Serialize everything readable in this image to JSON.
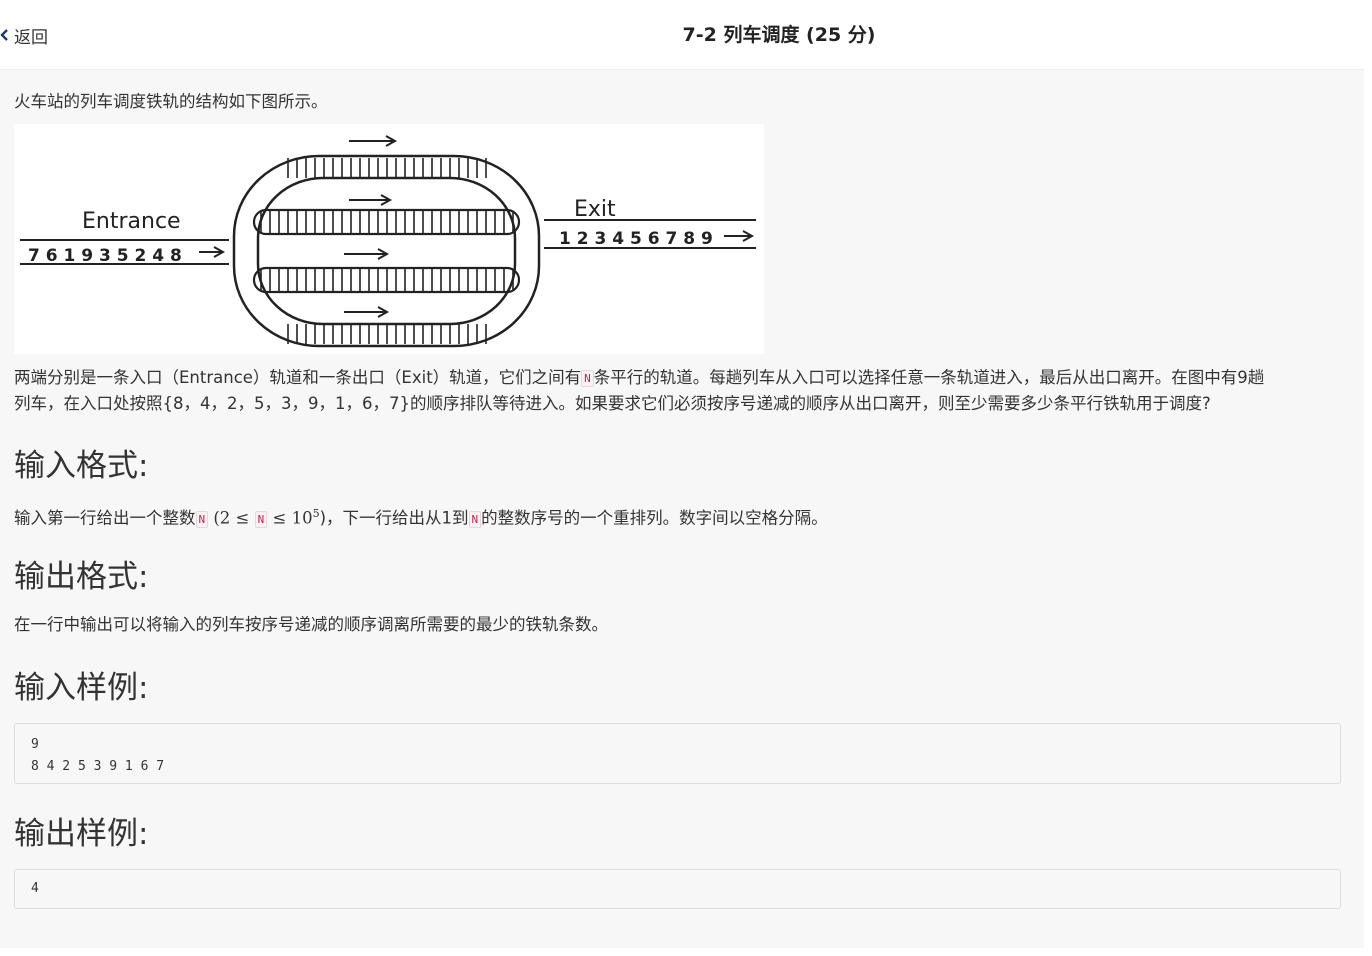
{
  "header": {
    "back_label": "返回",
    "title": "7-2 列车调度 (25 分)"
  },
  "problem": {
    "intro": "火车站的列车调度铁轨的结构如下图所示。",
    "figure": {
      "entrance_label": "Entrance",
      "exit_label": "Exit",
      "entrance_sequence": "7 6 1 9 3 5 2 4 8",
      "exit_sequence": "1 2 3 4 5 6 7 8 9"
    },
    "desc_line1_a": "两端分别是一条入口（Entrance）轨道和一条出口（Exit）轨道，它们之间有",
    "desc_var_n": "N",
    "desc_line1_b": "条平行的轨道。每趟列车从入口可以选择任意一条轨道进入，最后从出口离开。在图中有9趟",
    "desc_line2": "列车，在入口处按照{8，4，2，5，3，9，1，6，7}的顺序排队等待进入。如果要求它们必须按序号递减的顺序从出口离开，则至少需要多少条平行铁轨用于调度?"
  },
  "input_format": {
    "heading": "输入格式:",
    "text_a": "输入第一行给出一个整数",
    "var_n": "N",
    "math_a": " (2 ≤ ",
    "math_b": " ≤ 10",
    "math_exp": "5",
    "text_b": ")，下一行给出从1到",
    "text_c": "的整数序号的一个重排列。数字间以空格分隔。"
  },
  "output_format": {
    "heading": "输出格式:",
    "text": "在一行中输出可以将输入的列车按序号递减的顺序调离所需要的最少的铁轨条数。"
  },
  "sample_input": {
    "heading": "输入样例:",
    "line1": "9",
    "line2": "8 4 2 5 3 9 1 6 7"
  },
  "sample_output": {
    "heading": "输出样例:",
    "line1": "4"
  }
}
